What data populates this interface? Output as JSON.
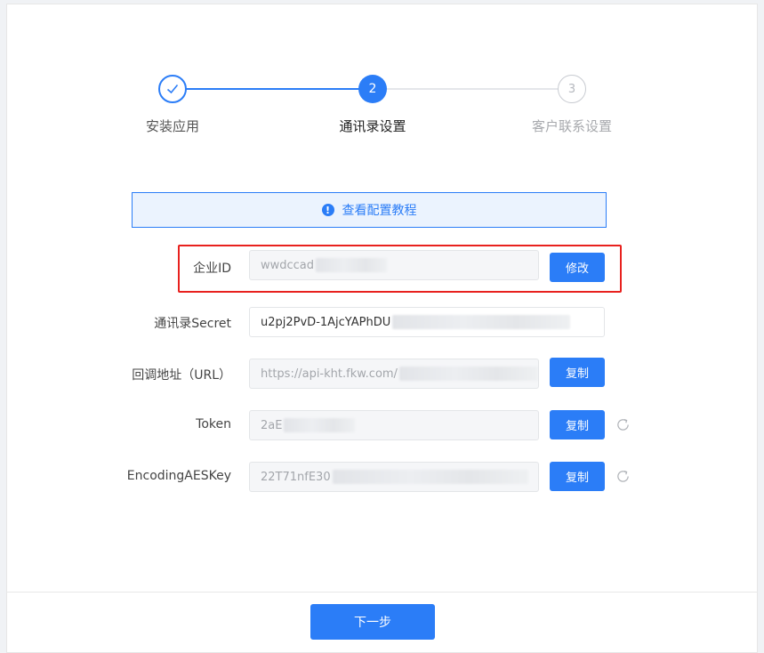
{
  "steps": [
    {
      "label": "安装应用",
      "status": "done"
    },
    {
      "label": "通讯录设置",
      "number": "2",
      "status": "active"
    },
    {
      "label": "客户联系设置",
      "number": "3",
      "status": "pending"
    }
  ],
  "banner": {
    "text": "查看配置教程",
    "icon": "info-icon"
  },
  "form": {
    "corp_id": {
      "label": "企业ID",
      "value": "wwdccad",
      "button": "修改"
    },
    "contacts_secret": {
      "label": "通讯录Secret",
      "value": "u2pj2PvD-1AjcYAPhDU"
    },
    "callback_url": {
      "label": "回调地址（URL）",
      "value": "https://api-kht.fkw.com/",
      "button": "复制"
    },
    "token": {
      "label": "Token",
      "value": "2aE",
      "button": "复制",
      "refresh_icon": "refresh-icon"
    },
    "aes_key": {
      "label": "EncodingAESKey",
      "value": "22T71nfE30",
      "button": "复制",
      "refresh_icon": "refresh-icon"
    }
  },
  "next_button": "下一步",
  "colors": {
    "primary": "#2b7df7",
    "highlight": "#e8211e"
  }
}
